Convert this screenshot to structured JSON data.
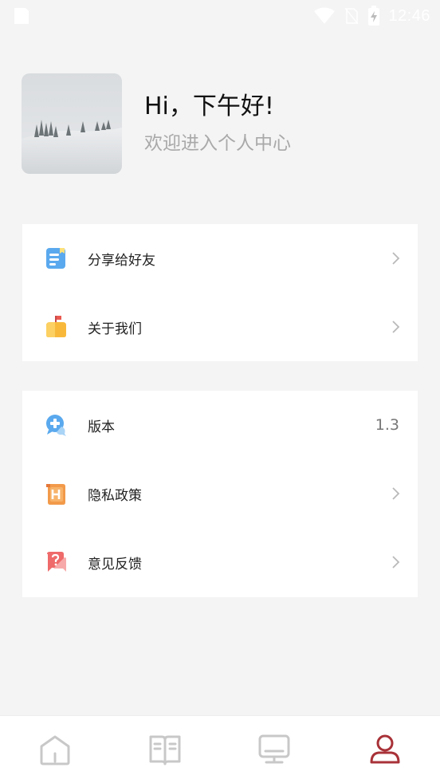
{
  "status_bar": {
    "time": "12:46",
    "icons": [
      "sim-card-icon",
      "wifi-icon",
      "no-sim-icon",
      "battery-charging-icon"
    ]
  },
  "profile": {
    "greeting": "Hi，下午好!",
    "welcome": "欢迎进入个人中心"
  },
  "menu_group_1": {
    "items": [
      {
        "label": "分享给好友",
        "icon": "share-book-icon"
      },
      {
        "label": "关于我们",
        "icon": "mailbox-flag-icon"
      }
    ]
  },
  "menu_group_2": {
    "items": [
      {
        "label": "版本",
        "icon": "version-bubble-icon",
        "value": "1.3"
      },
      {
        "label": "隐私政策",
        "icon": "privacy-scroll-icon"
      },
      {
        "label": "意见反馈",
        "icon": "feedback-question-icon"
      }
    ]
  },
  "bottom_nav": {
    "items": [
      "home-icon",
      "book-icon",
      "monitor-icon",
      "profile-icon"
    ],
    "active": "profile-icon"
  },
  "colors": {
    "background": "#f4f4f4",
    "card": "#ffffff",
    "accent_active_tab": "#a83238",
    "muted_text": "#a9a9a9",
    "inactive_icon": "#c8c8c8"
  }
}
